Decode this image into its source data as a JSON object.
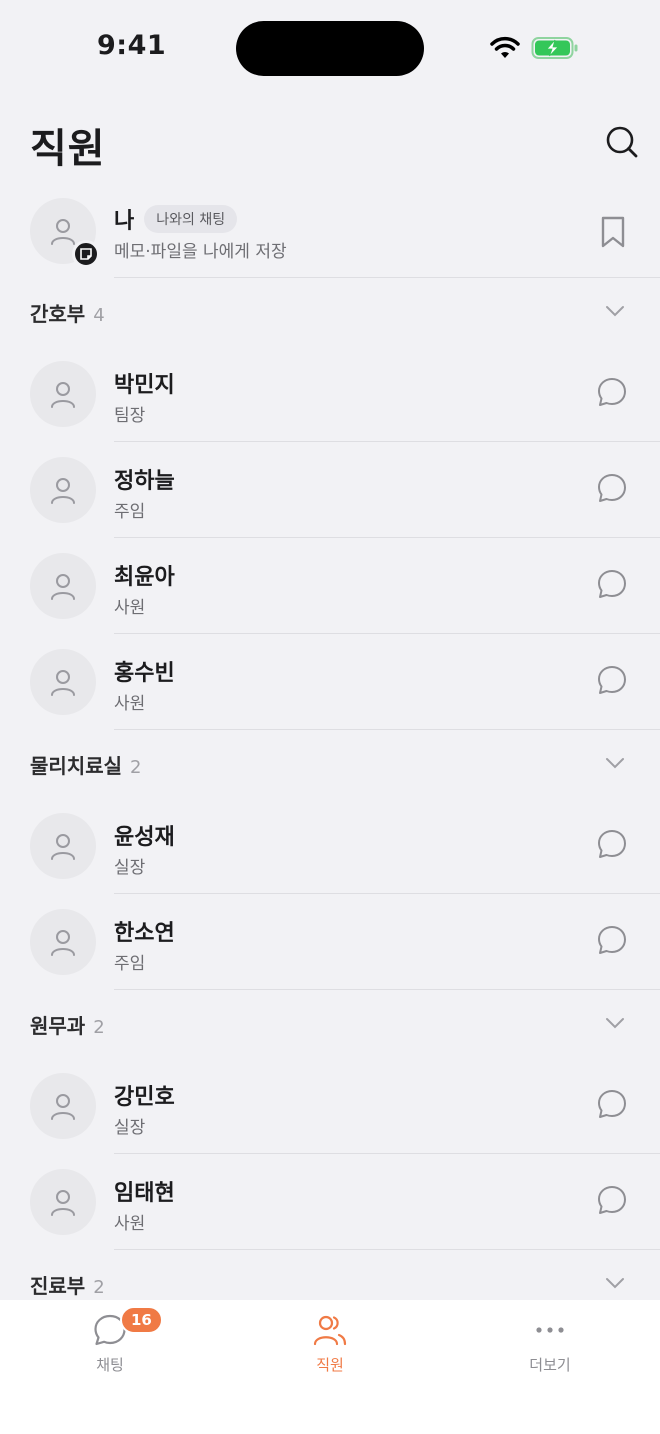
{
  "status_bar": {
    "time": "9:41"
  },
  "header": {
    "title": "직원"
  },
  "me": {
    "name": "나",
    "tag": "나와의 채팅",
    "subtitle": "메모·파일을 나에게 저장"
  },
  "groups": [
    {
      "name": "간호부",
      "count": "4",
      "members": [
        {
          "name": "박민지",
          "role": "팀장"
        },
        {
          "name": "정하늘",
          "role": "주임"
        },
        {
          "name": "최윤아",
          "role": "사원"
        },
        {
          "name": "홍수빈",
          "role": "사원"
        }
      ]
    },
    {
      "name": "물리치료실",
      "count": "2",
      "members": [
        {
          "name": "윤성재",
          "role": "실장"
        },
        {
          "name": "한소연",
          "role": "주임"
        }
      ]
    },
    {
      "name": "원무과",
      "count": "2",
      "members": [
        {
          "name": "강민호",
          "role": "실장"
        },
        {
          "name": "임태현",
          "role": "사원"
        }
      ]
    },
    {
      "name": "진료부",
      "count": "2",
      "members": []
    }
  ],
  "tab_bar": {
    "tabs": [
      {
        "label": "채팅",
        "icon": "chat-bubble-icon",
        "badge": "16",
        "active": false
      },
      {
        "label": "직원",
        "icon": "people-icon",
        "active": true
      },
      {
        "label": "더보기",
        "icon": "more-dots-icon",
        "active": false
      }
    ]
  },
  "colors": {
    "accent": "#f07a45",
    "background": "#f2f2f5",
    "battery": "#34c759"
  }
}
